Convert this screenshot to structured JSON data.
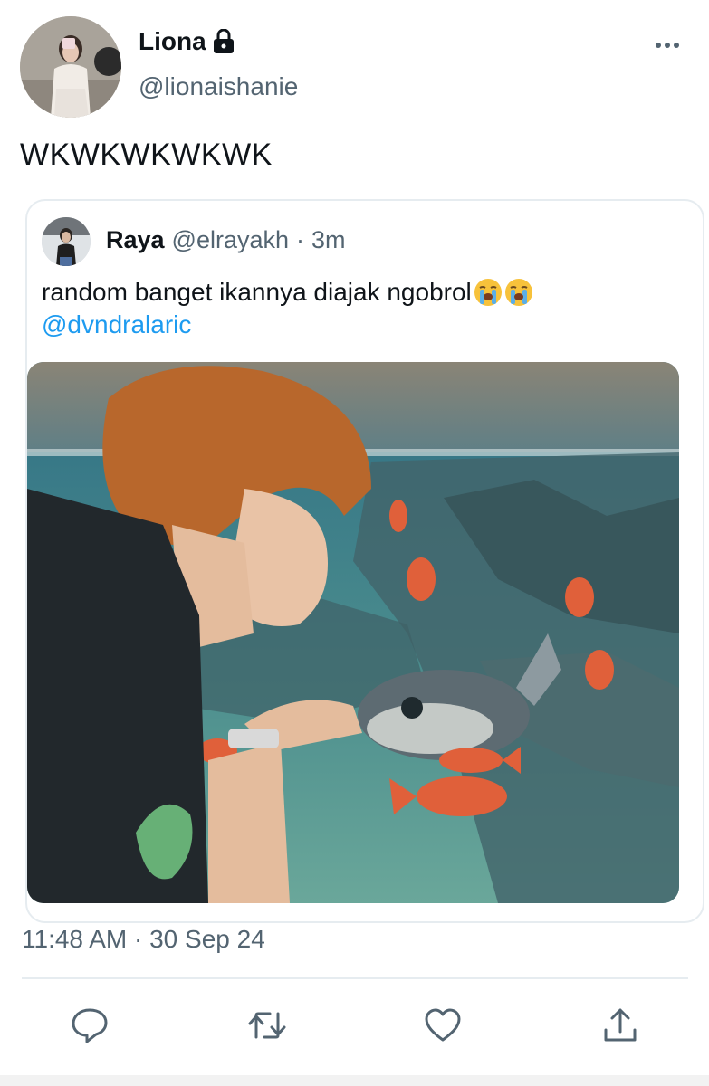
{
  "author": {
    "name": "Liona",
    "handle": "@lionaishanie",
    "protected_icon": "lock-icon"
  },
  "tweet": {
    "text": "WKWKWKWKWK",
    "timestamp": "11:48 AM · 30 Sep 24"
  },
  "quoted_tweet": {
    "name": "Raya",
    "handle": "@elrayakh",
    "separator": "·",
    "time": "3m",
    "text": "random banget ikannya diajak ngobrol",
    "emojis": [
      "loudly-crying-face-icon",
      "loudly-crying-face-icon"
    ],
    "mention": "@dvndralaric",
    "media_icon": "photo-person-aquarium-image"
  },
  "actions": {
    "reply_icon": "reply-icon",
    "retweet_icon": "retweet-icon",
    "like_icon": "heart-icon",
    "share_icon": "share-icon"
  },
  "colors": {
    "text": "#0f1419",
    "secondary": "#536471",
    "link": "#1d9bf0",
    "border": "#e6ecf0"
  }
}
